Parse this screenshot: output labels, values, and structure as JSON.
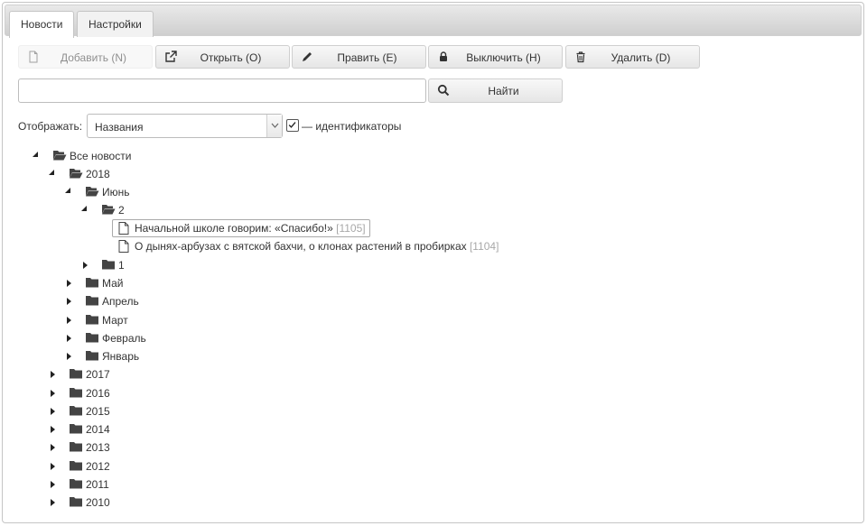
{
  "tabs": [
    {
      "label": "Новости",
      "active": true
    },
    {
      "label": "Настройки",
      "active": false
    }
  ],
  "toolbar": {
    "add": "Добавить (N)",
    "open": "Открыть (O)",
    "edit": "Править (E)",
    "disable": "Выключить (H)",
    "delete": "Удалить (D)"
  },
  "search": {
    "value": "",
    "placeholder": "",
    "button": "Найти"
  },
  "display": {
    "label": "Отображать:",
    "selected": "Названия",
    "checkbox_label": "— идентификаторы",
    "checkbox_checked": true
  },
  "tree": {
    "root": "Все новости",
    "year_2018": "2018",
    "month_june": "Июнь",
    "day_2": "2",
    "docs": [
      {
        "title": "Начальной школе говорим: «Спасибо!»",
        "id": "[1105]",
        "selected": true
      },
      {
        "title": "О дынях-арбузах с вятской бахчи, о клонах растений в пробирках",
        "id": "[1104]",
        "selected": false
      }
    ],
    "day_1": "1",
    "months": [
      "Май",
      "Апрель",
      "Март",
      "Февраль",
      "Январь"
    ],
    "years": [
      "2017",
      "2016",
      "2015",
      "2014",
      "2013",
      "2012",
      "2011",
      "2010"
    ]
  },
  "colors": {
    "accent": "#333333",
    "id_gray": "#a8a8a8",
    "border": "#c5c5c5"
  }
}
